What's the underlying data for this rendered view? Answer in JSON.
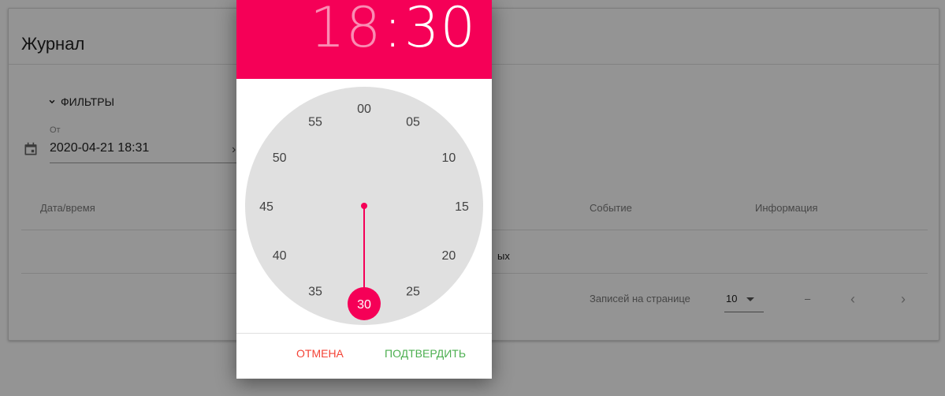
{
  "page": {
    "title": "Журнал",
    "filters_label": "ФИЛЬТРЫ",
    "date_from_label": "От",
    "date_from_value": "2020-04-21 18:31",
    "columns": [
      "Дата/время",
      "Событие",
      "Информация"
    ],
    "no_data_text": "ых",
    "rows_per_page_label": "Записей на странице",
    "rows_per_page_value": "10",
    "range_text": "–"
  },
  "picker": {
    "hours": "18",
    "separator": ":",
    "minutes": "30",
    "selected_minute": 30,
    "minute_labels": [
      "00",
      "05",
      "10",
      "15",
      "20",
      "25",
      "30",
      "35",
      "40",
      "45",
      "50",
      "55"
    ],
    "cancel_label": "ОТМЕНА",
    "confirm_label": "ПОДТВЕРДИТЬ"
  },
  "colors": {
    "accent": "#f50057",
    "clock_bg": "#e0e0e0",
    "cancel": "#f44336",
    "confirm": "#4caf50"
  }
}
